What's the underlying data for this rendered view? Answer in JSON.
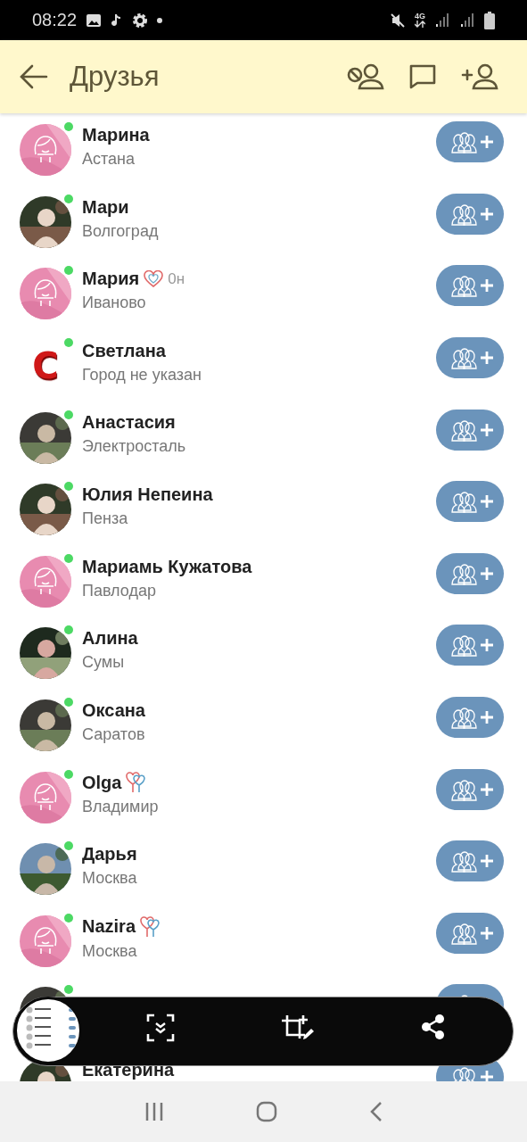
{
  "status_bar": {
    "time": "08:22",
    "network": "4G"
  },
  "header": {
    "title": "Друзья"
  },
  "friends": [
    {
      "name": "Марина",
      "city": "Астана",
      "online": true,
      "avatar": {
        "kind": "placeholder"
      }
    },
    {
      "name": "Мари",
      "city": "Волгоград",
      "online": true
    },
    {
      "name": "Мария",
      "city": "Иваново",
      "online": true,
      "avatar": {
        "kind": "placeholder"
      },
      "badge": {
        "kind": "heart",
        "text": "0н"
      }
    },
    {
      "name": "Светлана",
      "city": "Город не указан",
      "online": true,
      "avatar": {
        "kind": "letter",
        "letter": "С"
      }
    },
    {
      "name": "Анастасия",
      "city": "Электросталь",
      "online": true
    },
    {
      "name": "Юлия Непеина",
      "city": "Пенза",
      "online": true
    },
    {
      "name": "Мариамь Кужатова",
      "city": "Павлодар",
      "online": true,
      "avatar": {
        "kind": "placeholder"
      }
    },
    {
      "name": "Алина",
      "city": "Сумы",
      "online": true
    },
    {
      "name": "Оксана",
      "city": "Саратов",
      "online": true
    },
    {
      "name": "Olga",
      "city": "Владимир",
      "online": true,
      "avatar": {
        "kind": "placeholder"
      },
      "badge": {
        "kind": "balloons"
      }
    },
    {
      "name": "Дарья",
      "city": "Москва",
      "online": true
    },
    {
      "name": "Nazira",
      "city": "Москва",
      "online": true,
      "avatar": {
        "kind": "placeholder"
      },
      "badge": {
        "kind": "balloons"
      }
    },
    {
      "online": true
    },
    {
      "name": "Екатерина"
    }
  ]
}
